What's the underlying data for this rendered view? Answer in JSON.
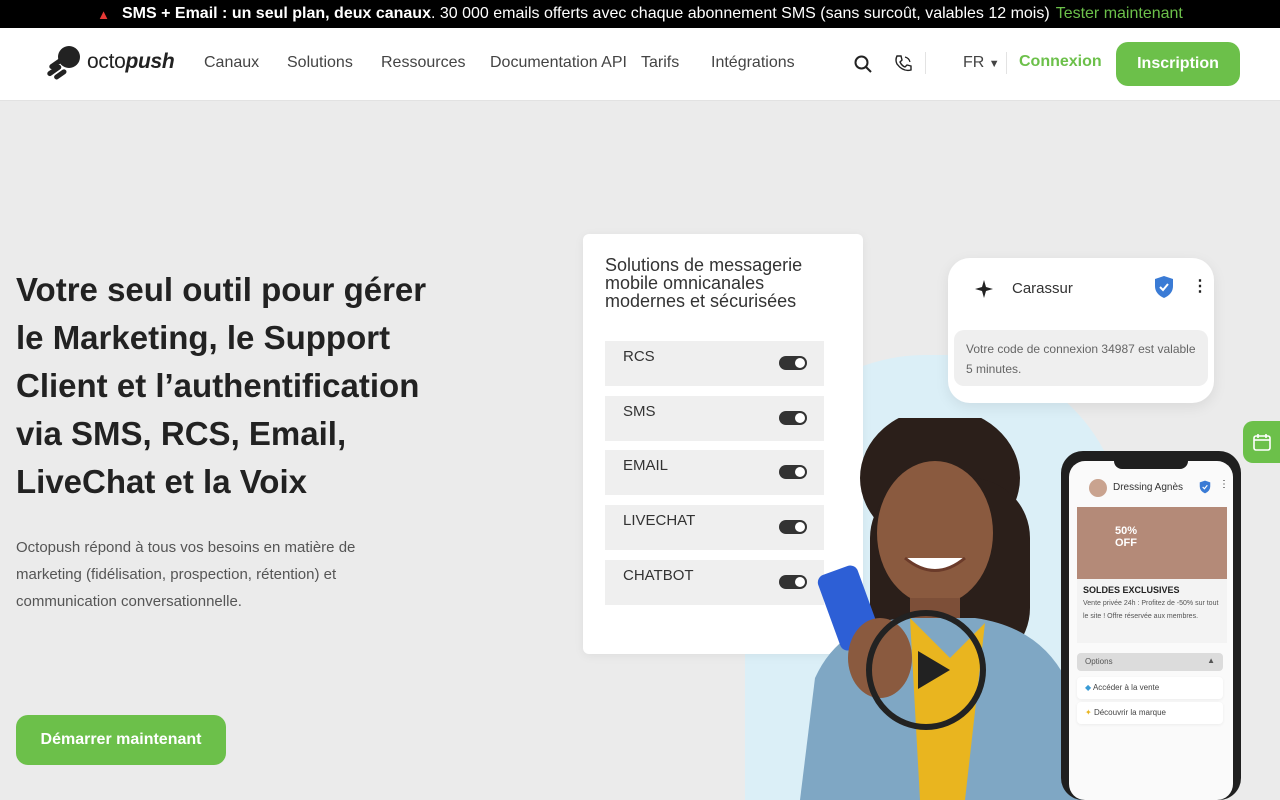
{
  "promo": {
    "bold_text": "SMS + Email : un seul plan, deux canaux",
    "text": ". 30 000 emails offerts avec chaque abonnement SMS (sans surcoût, valables 12 mois)",
    "link": "Tester maintenant"
  },
  "header": {
    "logo_text_a": "octo",
    "logo_text_b": "push",
    "nav": [
      "Canaux",
      "Solutions",
      "Ressources",
      "Documentation API",
      "Tarifs",
      "Intégrations"
    ],
    "language": "FR",
    "login": "Connexion",
    "signup": "Inscription"
  },
  "hero": {
    "title": "Votre seul outil pour gérer le Marketing, le Support Client et l’authentification via SMS, RCS, Email, LiveChat et la Voix",
    "description": "Octopush répond à tous vos besoins en matière de marketing (fidélisation, prospection, rétention) et communication conversationnelle.",
    "cta": "Démarrer maintenant"
  },
  "solutions_card": {
    "title": "Solutions de messagerie mobile omnicanales modernes et sécurisées",
    "channels": [
      "RCS",
      "SMS",
      "EMAIL",
      "LIVECHAT",
      "CHATBOT"
    ]
  },
  "message_card": {
    "sender": "Carassur",
    "message": "Votre code de connexion 34987 est valable 5 minutes."
  },
  "phone": {
    "sender": "Dressing Agnès",
    "promo": "50% OFF",
    "headline": "SOLDES EXCLUSIVES",
    "body": "Vente privée 24h : Profitez de -50% sur tout le site ! Offre réservée aux membres.",
    "options_label": "Options",
    "option_1": "Accéder à la vente",
    "option_2": "Découvrir la marque"
  },
  "colors": {
    "accent": "#6cc04a",
    "banner": "#000000",
    "background": "#ebebeb"
  }
}
